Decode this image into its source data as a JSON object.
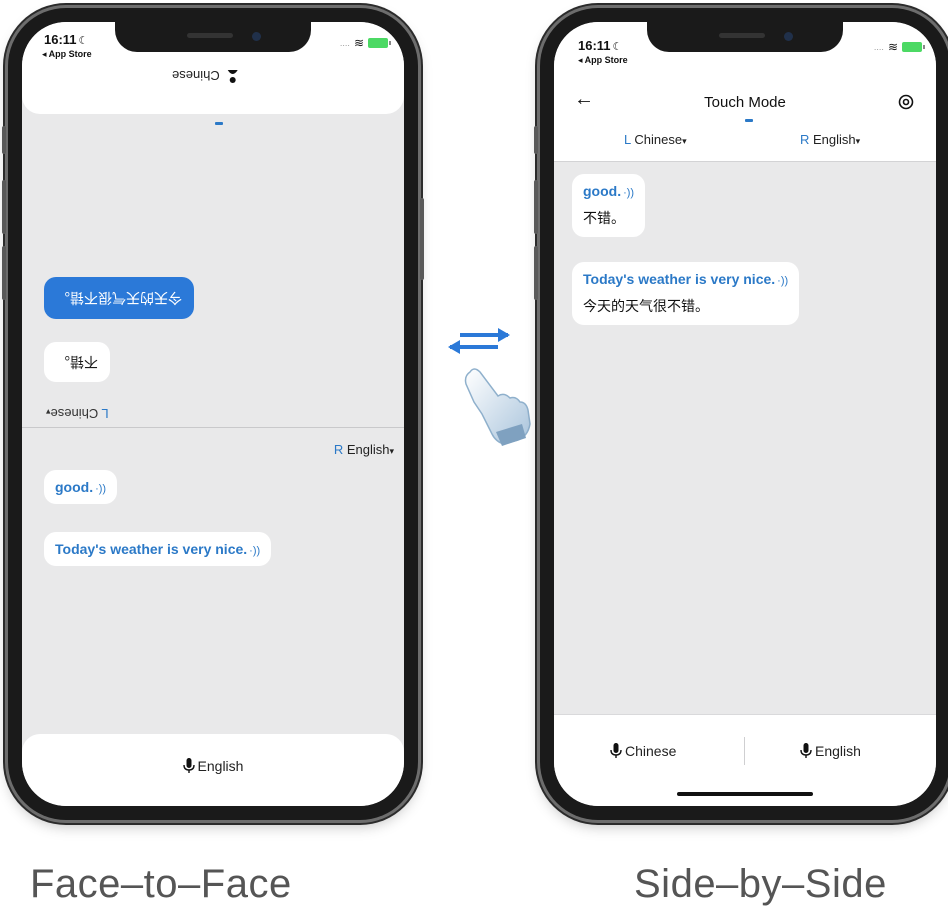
{
  "status_bar": {
    "time": "16:11",
    "back_label": "◂ App Store"
  },
  "face_to_face": {
    "top_lang": "Chinese",
    "flipped_messages": {
      "blue": "今天的天气很不错。",
      "white": "不错。"
    },
    "flipped_lang": {
      "side": "L",
      "lang": "Chinese"
    },
    "right_lang": {
      "side": "R",
      "lang": "English"
    },
    "messages": [
      {
        "en": "good."
      },
      {
        "en": "Today's weather is very nice."
      }
    ],
    "bottom_mic_label": "English",
    "caption": "Face–to–Face"
  },
  "side_by_side": {
    "title": "Touch Mode",
    "left_lang": {
      "side": "L",
      "lang": "Chinese"
    },
    "right_lang": {
      "side": "R",
      "lang": "English"
    },
    "messages": [
      {
        "en": "good.",
        "zh": "不错。"
      },
      {
        "en": "Today's weather is very nice.",
        "zh": "今天的天气很不错。"
      }
    ],
    "mic_left_label": "Chinese",
    "mic_right_label": "English",
    "caption": "Side–by–Side"
  },
  "colors": {
    "accent": "#2b79c7",
    "bubble_blue": "#2b79d8",
    "screen_bg": "#e9e9ea"
  },
  "icons": [
    "back-arrow-icon",
    "settings-icon",
    "microphone-icon",
    "speaker-icon",
    "swap-arrows-icon",
    "hand-pointer-icon",
    "person-mic-icon"
  ]
}
